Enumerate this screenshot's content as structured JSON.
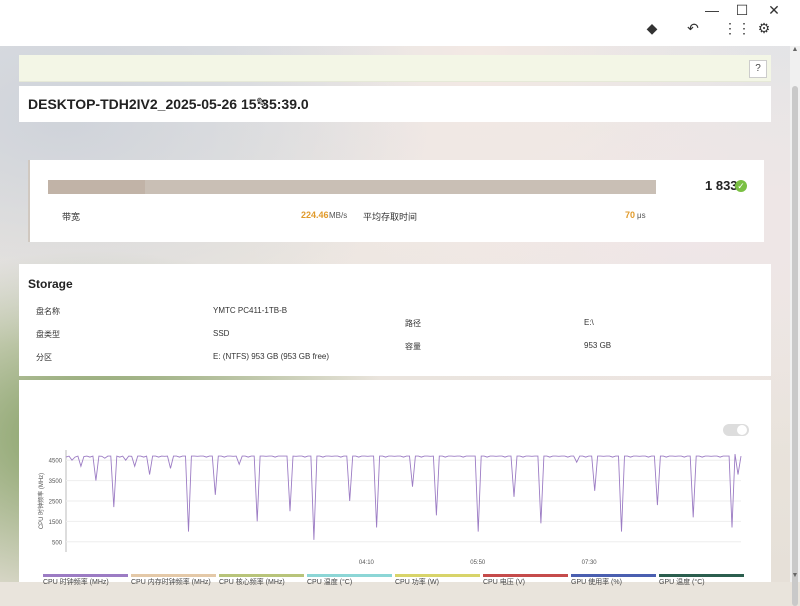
{
  "window": {
    "minimize": "—",
    "maximize": "☐",
    "close": "✕"
  },
  "toolbar": {
    "icons": [
      "pin-icon",
      "undo-icon",
      "grid-icon",
      "settings-icon"
    ]
  },
  "help": {
    "label": "?"
  },
  "header": {
    "title": "DESKTOP-TDH2IV2_2025-05-26 15:35:39.0"
  },
  "result": {
    "score": "1 833",
    "bar_fill": 0.16,
    "bandwidth_label": "带宽",
    "bandwidth_value": "224.46",
    "bandwidth_unit": "MB/s",
    "latency_label": "平均存取时间",
    "latency_value": "70",
    "latency_unit": "μs"
  },
  "storage": {
    "title": "Storage",
    "rows": [
      {
        "label": "盘名称",
        "value": "YMTC PC411-1TB-B"
      },
      {
        "label": "盘类型",
        "value": "SSD"
      },
      {
        "label": "分区",
        "value": "E: (NTFS) 953 GB (953 GB free)"
      }
    ],
    "right_rows": [
      {
        "label": "路径",
        "value": "E:\\"
      },
      {
        "label": "容量",
        "value": "953 GB"
      }
    ]
  },
  "chart_data": {
    "type": "line",
    "ylabel": "CPU 时钟频率 (MHz)",
    "yticks": [
      "4500",
      "3500",
      "2500",
      "1500",
      "500"
    ],
    "xticks": [
      "04:10",
      "05:50",
      "07:30"
    ],
    "ylim": [
      0,
      5000
    ],
    "series": [
      {
        "color": "#9c7cc4",
        "values": [
          4650,
          4700,
          4500,
          4650,
          4700,
          4200,
          4680,
          4700,
          4650,
          4700,
          3500,
          4700,
          4690,
          4600,
          4700,
          4700,
          2200,
          4700,
          4650,
          4700,
          4500,
          4700,
          4690,
          4200,
          4700,
          4700,
          4650,
          4700,
          3800,
          4700,
          4700,
          4650,
          4700,
          4690,
          4700,
          4100,
          4700,
          4700,
          4650,
          4700,
          4700,
          1000,
          4700,
          4700,
          4690,
          4700,
          4700,
          4650,
          4700,
          4700,
          2800,
          4700,
          4700,
          4650,
          4700,
          4700,
          4690,
          4700,
          4300,
          4700,
          4700,
          4650,
          4700,
          4700,
          1500,
          4700,
          4700,
          4690,
          4700,
          4700,
          4650,
          4700,
          4700,
          4700,
          4700,
          2000,
          4700,
          4690,
          4700,
          4700,
          4650,
          4700,
          4700,
          600,
          4700,
          4700,
          4650,
          4700,
          4700,
          4690,
          4700,
          4700,
          4650,
          4700,
          4700,
          2500,
          4700,
          4700,
          4650,
          4700,
          4700,
          4690,
          4700,
          4700,
          1200,
          4700,
          4700,
          4650,
          4700,
          4700,
          4690,
          4700,
          4700,
          4650,
          4700,
          4700,
          3200,
          4700,
          4700,
          4650,
          4700,
          4700,
          4690,
          4700,
          1800,
          4700,
          4700,
          4650,
          4700,
          4700,
          4690,
          4700,
          4700,
          4650,
          4700,
          4700,
          4700,
          4700,
          1000,
          4700,
          4700,
          4650,
          4700,
          4700,
          4690,
          4700,
          4700,
          4650,
          4700,
          4700,
          2700,
          4700,
          4700,
          4650,
          4700,
          4700,
          4690,
          4700,
          4700,
          1400,
          4700,
          4700,
          4650,
          4700,
          4700,
          4690,
          4700,
          4700,
          4650,
          4700,
          4700,
          4400,
          4700,
          4700,
          4650,
          4700,
          4700,
          3000,
          4700,
          4700,
          4690,
          4700,
          4700,
          4650,
          4700,
          4700,
          1000,
          4700,
          4700,
          4650,
          4700,
          4700,
          4690,
          4700,
          4700,
          4650,
          4700,
          4700,
          2300,
          4700,
          4700,
          4650,
          4700,
          4700,
          4690,
          4700,
          4700,
          4650,
          4700,
          4700,
          1700,
          4700,
          4700,
          4650,
          4700,
          4700,
          4690,
          4700,
          4700,
          4650,
          4700,
          4700,
          4700,
          1200,
          4800,
          3800,
          4700
        ]
      }
    ]
  },
  "legend": [
    {
      "label": "CPU 时钟频率 (MHz)",
      "color": "#9c7cc4"
    },
    {
      "label": "CPU 内存时钟频率 (MHz)",
      "color": "#e4c9a8"
    },
    {
      "label": "CPU 核心频率 (MHz)",
      "color": "#b8c47a"
    },
    {
      "label": "CPU 温度 (°C)",
      "color": "#8cd6d6"
    },
    {
      "label": "CPU 功率 (W)",
      "color": "#d8d46a"
    },
    {
      "label": "CPU 电压 (V)",
      "color": "#c54b4b"
    },
    {
      "label": "GPU 使用率 (%)",
      "color": "#4a5fb0"
    },
    {
      "label": "GPU 温度 (°C)",
      "color": "#2b5e4e"
    }
  ]
}
